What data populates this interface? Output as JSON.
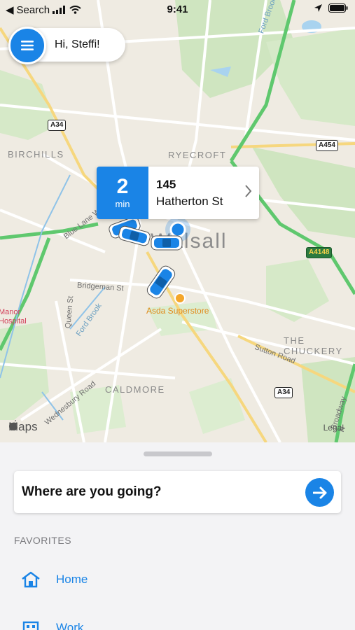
{
  "status_bar": {
    "back_label": "Search",
    "time": "9:41"
  },
  "greeting": {
    "text": "Hi, Steffi!"
  },
  "map": {
    "area_labels": [
      "BIRCHILLS",
      "RYECROFT",
      "THE CHUCKERY",
      "CALDMORE"
    ],
    "town_label": "Walsall",
    "streets": {
      "blue_lane": "Blue Lane W",
      "bridgeman": "Bridgeman St",
      "queen": "Queen St",
      "ford_brook_1": "Ford Brook",
      "ford_brook_2": "Ford Brook",
      "sutton": "Sutton Road",
      "wednesbury": "Wednesbury Road",
      "broadway": "Broadway N"
    },
    "road_shields": {
      "a34_top": "A34",
      "a454": "A454",
      "a4148": "A4148",
      "a34_bottom": "A34"
    },
    "poi": "Asda Superstore",
    "hospital": "Manor Hospital",
    "attribution": "Maps",
    "legal": "Legal"
  },
  "eta_card": {
    "minutes": "2",
    "unit": "min",
    "address_number": "145",
    "street": "Hatherton St"
  },
  "sheet": {
    "search_prompt": "Where are you going?",
    "favorites_header": "FAVORITES",
    "favorites": [
      {
        "label": "Home",
        "icon": "home-icon"
      },
      {
        "label": "Work",
        "icon": "work-icon"
      }
    ]
  },
  "colors": {
    "accent": "#1a84e6",
    "map_background": "#efebe2",
    "park_green": "#cfe5c0",
    "highway_green": "#5fc86e"
  }
}
